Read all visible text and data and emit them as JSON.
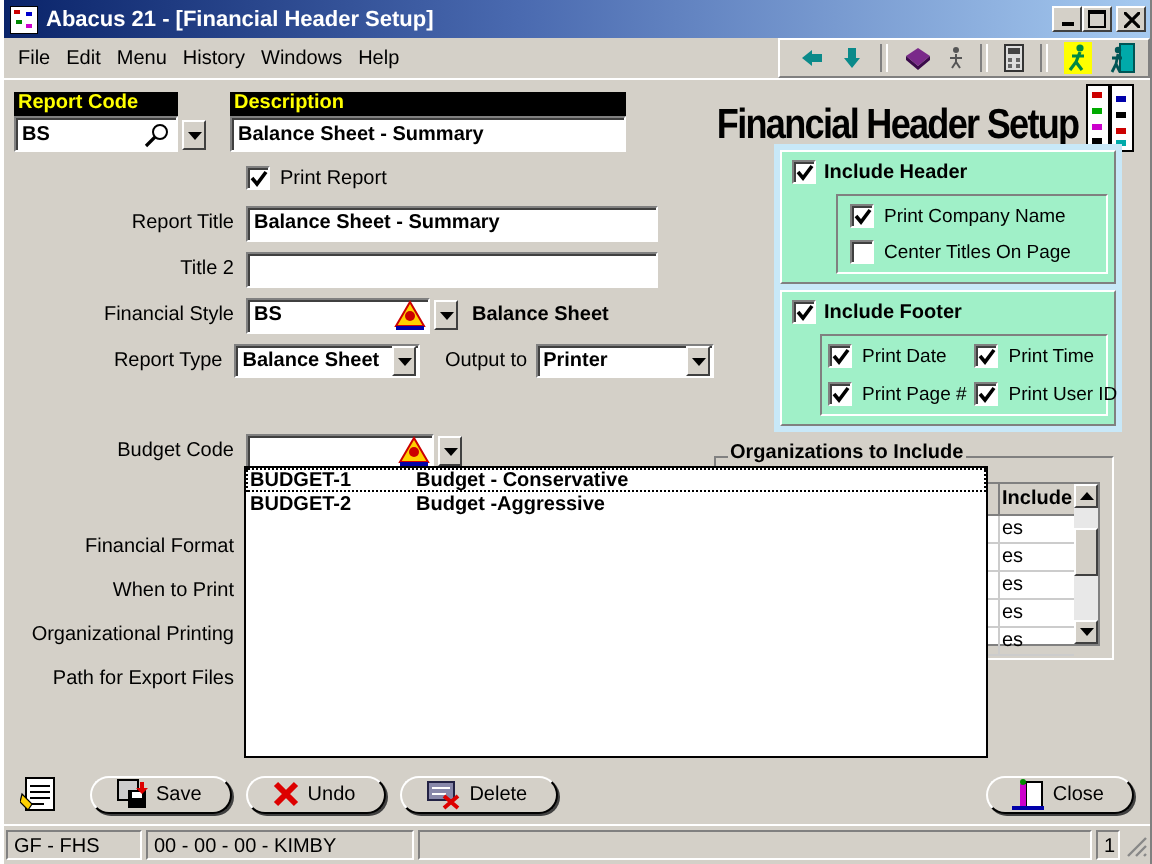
{
  "window": {
    "title": "Abacus 21 - [Financial Header Setup]"
  },
  "menu": [
    "File",
    "Edit",
    "Menu",
    "History",
    "Windows",
    "Help"
  ],
  "header": {
    "report_code": {
      "label": "Report Code",
      "value": "BS"
    },
    "description": {
      "label": "Description",
      "value": "Balance Sheet - Summary"
    },
    "title": "Financial Header Setup"
  },
  "form": {
    "print_report": {
      "label": "Print Report",
      "checked": true
    },
    "report_title": {
      "label": "Report Title",
      "value": "Balance Sheet - Summary"
    },
    "title_2": {
      "label": "Title 2"
    },
    "financial_style": {
      "label": "Financial Style",
      "value": "BS",
      "name": "Balance Sheet"
    },
    "report_type": {
      "label": "Report Type",
      "value": "Balance Sheet"
    },
    "output_to": {
      "label": "Output to",
      "value": "Printer"
    },
    "budget_code": {
      "label": "Budget Code"
    },
    "more_labels": [
      "Financial Format",
      "When to Print",
      "Organizational Printing",
      "Path for Export Files"
    ]
  },
  "header_options": {
    "label": "Include Header",
    "checked": true,
    "options": [
      {
        "label": "Print Company Name",
        "checked": true
      },
      {
        "label": "Center Titles On Page",
        "checked": false
      }
    ]
  },
  "footer_options": {
    "label": "Include Footer",
    "checked": true,
    "options": [
      {
        "label": "Print Date",
        "checked": true
      },
      {
        "label": "Print Time",
        "checked": true
      },
      {
        "label": "Print Page #",
        "checked": true
      },
      {
        "label": "Print User ID",
        "checked": true
      }
    ]
  },
  "organizations": {
    "title": "Organizations to Include",
    "column": "Include",
    "rows": [
      "es",
      "es",
      "es",
      "es",
      "es"
    ]
  },
  "budget_dropdown": [
    {
      "code": "BUDGET-1",
      "description": "Budget - Conservative",
      "selected": true
    },
    {
      "code": "BUDGET-2",
      "description": "Budget -Aggressive",
      "selected": false
    }
  ],
  "buttons": [
    {
      "label": "Save",
      "kind": "save"
    },
    {
      "label": "Undo",
      "kind": "undo"
    },
    {
      "label": "Delete",
      "kind": "delete"
    },
    {
      "label": "Close",
      "kind": "close"
    }
  ],
  "status_bar": [
    "GF - FHS",
    "00 - 00 - 00 - KIMBY",
    "1"
  ]
}
